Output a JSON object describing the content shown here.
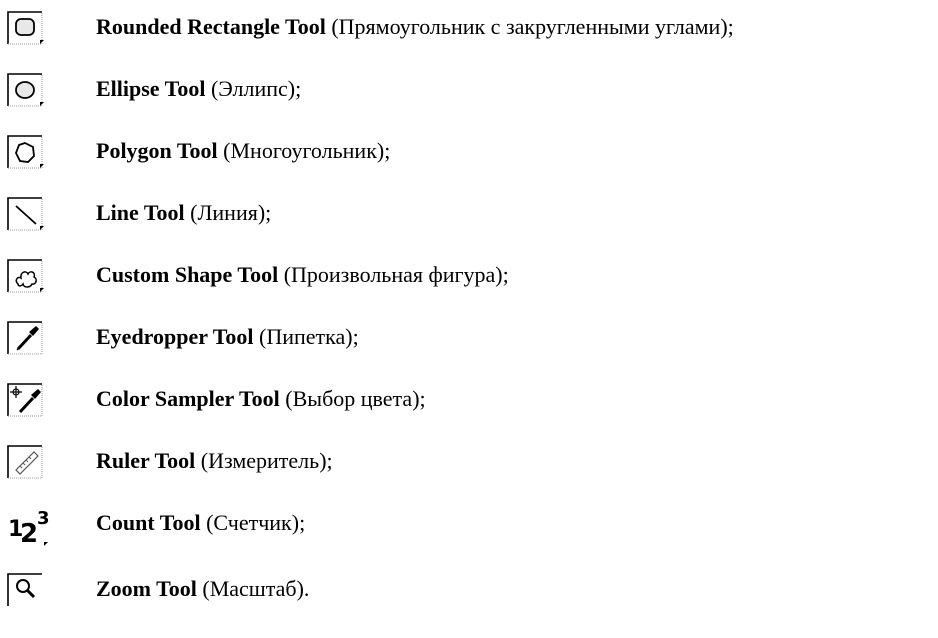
{
  "tools": [
    {
      "icon": "rounded-rectangle-icon",
      "name": "Rounded Rectangle Tool",
      "desc": " (Прямоугольник с закругленными углами);"
    },
    {
      "icon": "ellipse-icon",
      "name": "Ellipse Tool",
      "desc": " (Эллипс);"
    },
    {
      "icon": "polygon-icon",
      "name": "Polygon Tool",
      "desc": " (Многоугольник);"
    },
    {
      "icon": "line-icon",
      "name": "Line Tool",
      "desc": " (Линия);"
    },
    {
      "icon": "custom-shape-icon",
      "name": "Custom Shape Tool",
      "desc": " (Произвольная фигура);"
    },
    {
      "icon": "eyedropper-icon",
      "name": "Eyedropper Tool",
      "desc": " (Пипетка);"
    },
    {
      "icon": "color-sampler-icon",
      "name": "Color Sampler Tool",
      "desc": " (Выбор цвета);"
    },
    {
      "icon": "ruler-icon",
      "name": "Ruler Tool",
      "desc": " (Измеритель);"
    },
    {
      "icon": "count-icon",
      "name": "Count Tool",
      "desc": " (Счетчик);"
    },
    {
      "icon": "zoom-icon",
      "name": "Zoom Tool",
      "desc": " (Масштаб)."
    }
  ]
}
